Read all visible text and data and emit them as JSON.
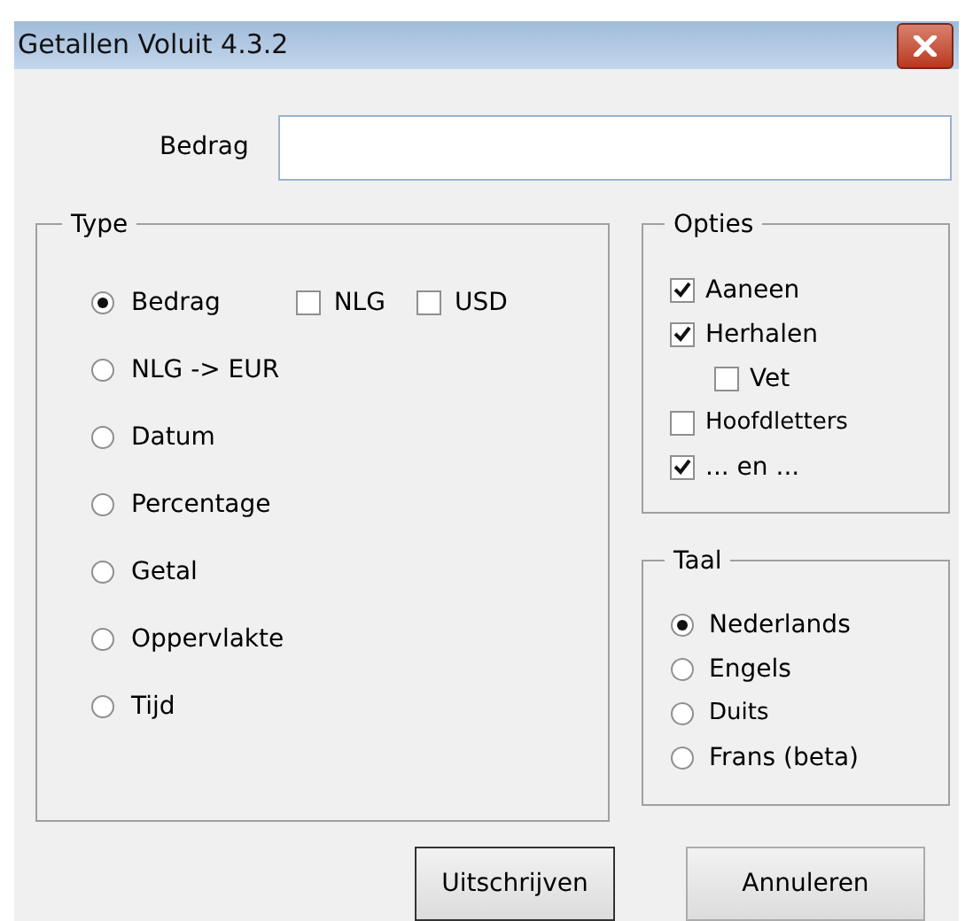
{
  "window": {
    "title": "Getallen Voluit 4.3.2"
  },
  "amount": {
    "label": "Bedrag"
  },
  "type_group": {
    "title": "Type",
    "options": [
      {
        "label": "Bedrag",
        "selected": true
      },
      {
        "label": "NLG -> EUR",
        "selected": false
      },
      {
        "label": "Datum",
        "selected": false
      },
      {
        "label": "Percentage",
        "selected": false
      },
      {
        "label": "Getal",
        "selected": false
      },
      {
        "label": "Oppervlakte",
        "selected": false
      },
      {
        "label": "Tijd",
        "selected": false
      }
    ],
    "currency_checkboxes": [
      {
        "label": "NLG",
        "checked": false
      },
      {
        "label": "USD",
        "checked": false
      }
    ]
  },
  "options_group": {
    "title": "Opties",
    "items": [
      {
        "label": "Aaneen",
        "checked": true,
        "indented": false
      },
      {
        "label": "Herhalen",
        "checked": true,
        "indented": false
      },
      {
        "label": "Vet",
        "checked": false,
        "indented": true
      },
      {
        "label": "Hoofdletters",
        "checked": false,
        "indented": false
      },
      {
        "label": "... en ...",
        "checked": true,
        "indented": false
      }
    ]
  },
  "language_group": {
    "title": "Taal",
    "options": [
      {
        "label": "Nederlands",
        "selected": true
      },
      {
        "label": "Engels",
        "selected": false
      },
      {
        "label": "Duits",
        "selected": false
      },
      {
        "label": "Frans (beta)",
        "selected": false
      }
    ]
  },
  "buttons": [
    "Uitschrijven",
    "Annuleren"
  ]
}
